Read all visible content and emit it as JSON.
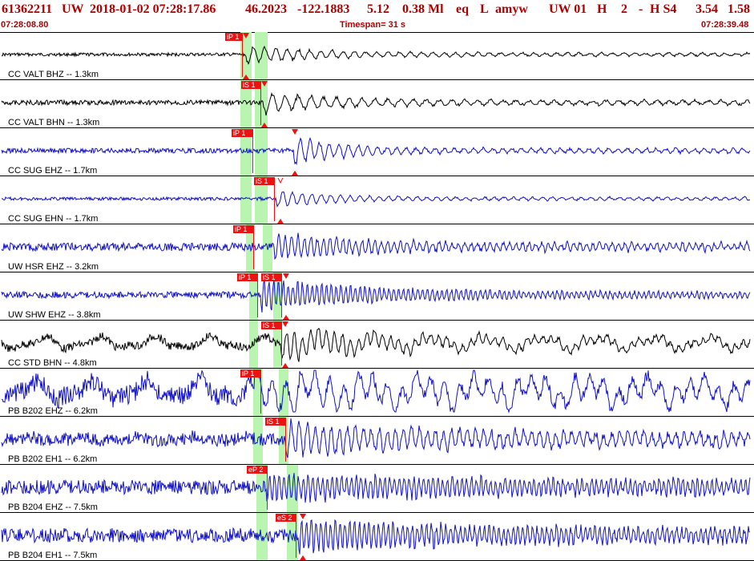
{
  "event": {
    "id": "61362211",
    "network": "UW",
    "datetime": "2018-01-02 07:28:17.86",
    "lat": "46.2023",
    "lon": "-122.1883",
    "depth": "5.12",
    "magnitude": "0.38 Ml",
    "etype": "eq",
    "status": "L",
    "author": "amyw",
    "source": "UW 01",
    "quality": "H",
    "count": "2",
    "dash": "-",
    "hs": "H S4",
    "val1": "3.54",
    "val2": "1.58"
  },
  "timebar": {
    "start": "07:28:08.80",
    "timespan": "Timespan=  31 s",
    "end": "07:28:39.48"
  },
  "colors": {
    "title": "#b00000",
    "pick": "#ee1111",
    "phase_window": "#b9f5b0",
    "trace_blue": "#1010c8",
    "trace_black": "#000000"
  },
  "channels": [
    {
      "label": "CC VALT BHZ -- 1.3km",
      "color": "black",
      "picks": [
        {
          "phase": "iP 1",
          "mark": "tri"
        }
      ]
    },
    {
      "label": "CC VALT BHN -- 1.3km",
      "color": "black",
      "picks": [
        {
          "phase": "iS 1",
          "mark": "tri"
        }
      ]
    },
    {
      "label": "CC SUG EHZ -- 1.7km",
      "color": "blue",
      "picks": [
        {
          "phase": "iP 1",
          "mark": "tri"
        }
      ]
    },
    {
      "label": "CC SUG EHN -- 1.7km",
      "color": "blue",
      "picks": [
        {
          "phase": "iS 1",
          "mark": "v"
        }
      ]
    },
    {
      "label": "UW HSR EHZ -- 3.2km",
      "color": "blue",
      "picks": [
        {
          "phase": "iP 1",
          "mark": ""
        }
      ]
    },
    {
      "label": "UW SHW EHZ -- 3.8km",
      "color": "blue",
      "picks": [
        {
          "phase": "iP 1",
          "mark": ""
        },
        {
          "phase": "iS 1",
          "mark": "tri"
        }
      ]
    },
    {
      "label": "CC STD BHN -- 4.8km",
      "color": "black",
      "picks": [
        {
          "phase": "iS 1",
          "mark": "tri"
        }
      ]
    },
    {
      "label": "PB B202 EHZ -- 6.2km",
      "color": "blue",
      "picks": [
        {
          "phase": "iP 1",
          "mark": ""
        }
      ]
    },
    {
      "label": "PB B202 EH1 -- 6.2km",
      "color": "blue",
      "picks": [
        {
          "phase": "iS 1",
          "mark": ""
        }
      ]
    },
    {
      "label": "PB B204 EHZ -- 7.5km",
      "color": "blue",
      "picks": [
        {
          "phase": "eP 2",
          "mark": ""
        }
      ]
    },
    {
      "label": "PB B204 EH1 -- 7.5km",
      "color": "blue",
      "picks": [
        {
          "phase": "eS 2",
          "mark": "tri"
        }
      ]
    }
  ]
}
